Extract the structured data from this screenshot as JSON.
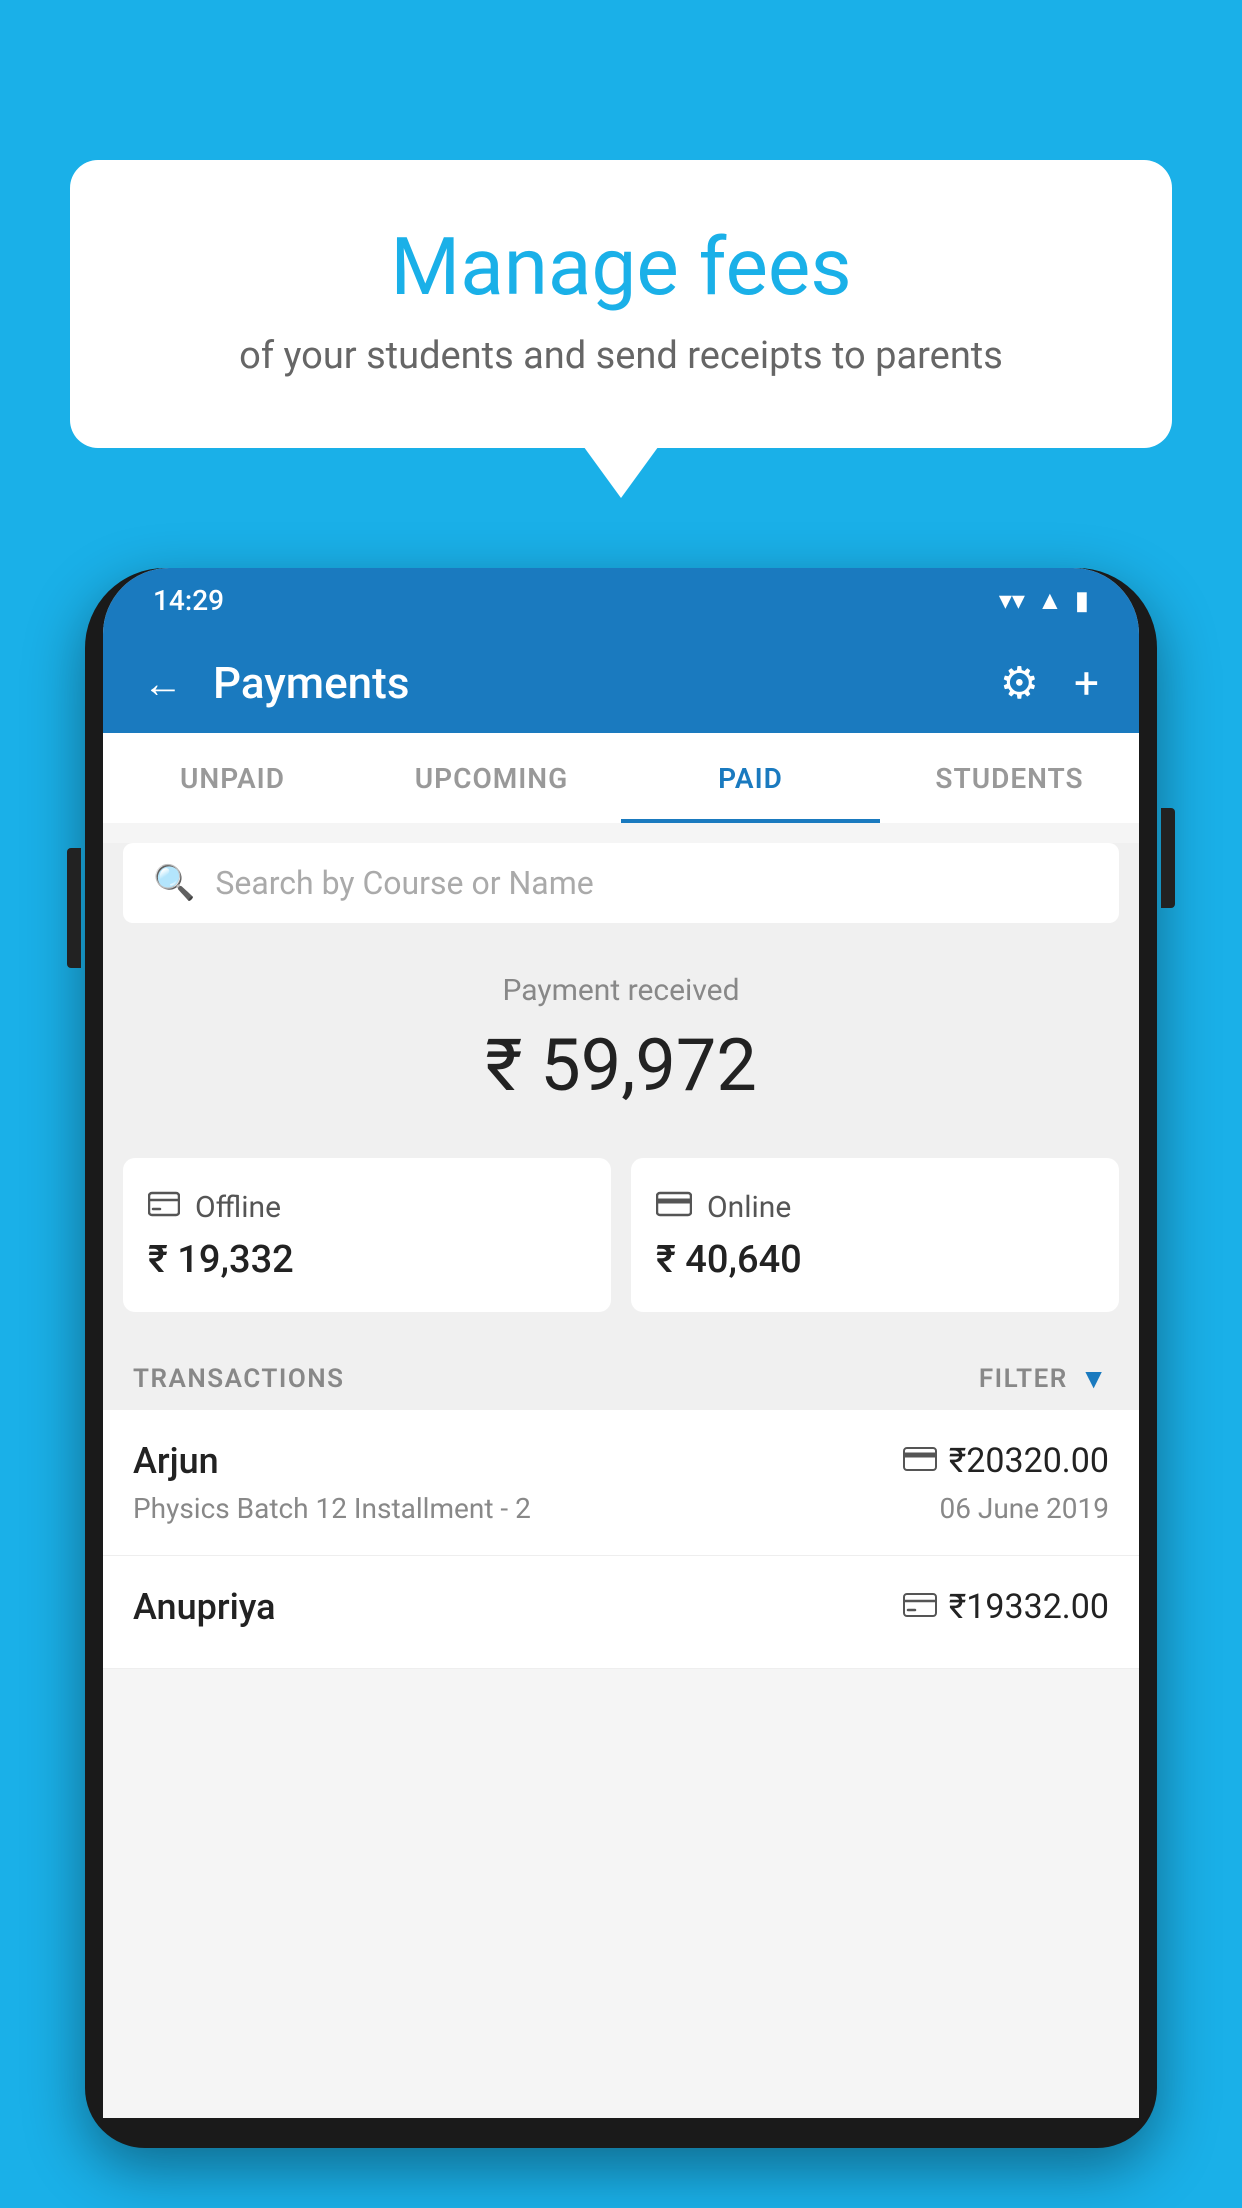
{
  "background_color": "#1ab0e8",
  "speech_bubble": {
    "title": "Manage fees",
    "subtitle": "of your students and send receipts to parents"
  },
  "status_bar": {
    "time": "14:29",
    "wifi": "▼",
    "signal": "◀",
    "battery": "▮"
  },
  "app_bar": {
    "title": "Payments",
    "back_label": "←",
    "settings_label": "⚙",
    "add_label": "+"
  },
  "tabs": [
    {
      "label": "UNPAID",
      "active": false
    },
    {
      "label": "UPCOMING",
      "active": false
    },
    {
      "label": "PAID",
      "active": true
    },
    {
      "label": "STUDENTS",
      "active": false
    }
  ],
  "search": {
    "placeholder": "Search by Course or Name"
  },
  "payment_summary": {
    "label": "Payment received",
    "total": "₹ 59,972",
    "offline": {
      "label": "Offline",
      "amount": "₹ 19,332"
    },
    "online": {
      "label": "Online",
      "amount": "₹ 40,640"
    }
  },
  "transactions": {
    "header": "TRANSACTIONS",
    "filter_label": "FILTER",
    "items": [
      {
        "name": "Arjun",
        "description": "Physics Batch 12 Installment - 2",
        "amount": "₹20320.00",
        "date": "06 June 2019",
        "payment_type": "online"
      },
      {
        "name": "Anupriya",
        "description": "",
        "amount": "₹19332.00",
        "date": "",
        "payment_type": "offline"
      }
    ]
  }
}
